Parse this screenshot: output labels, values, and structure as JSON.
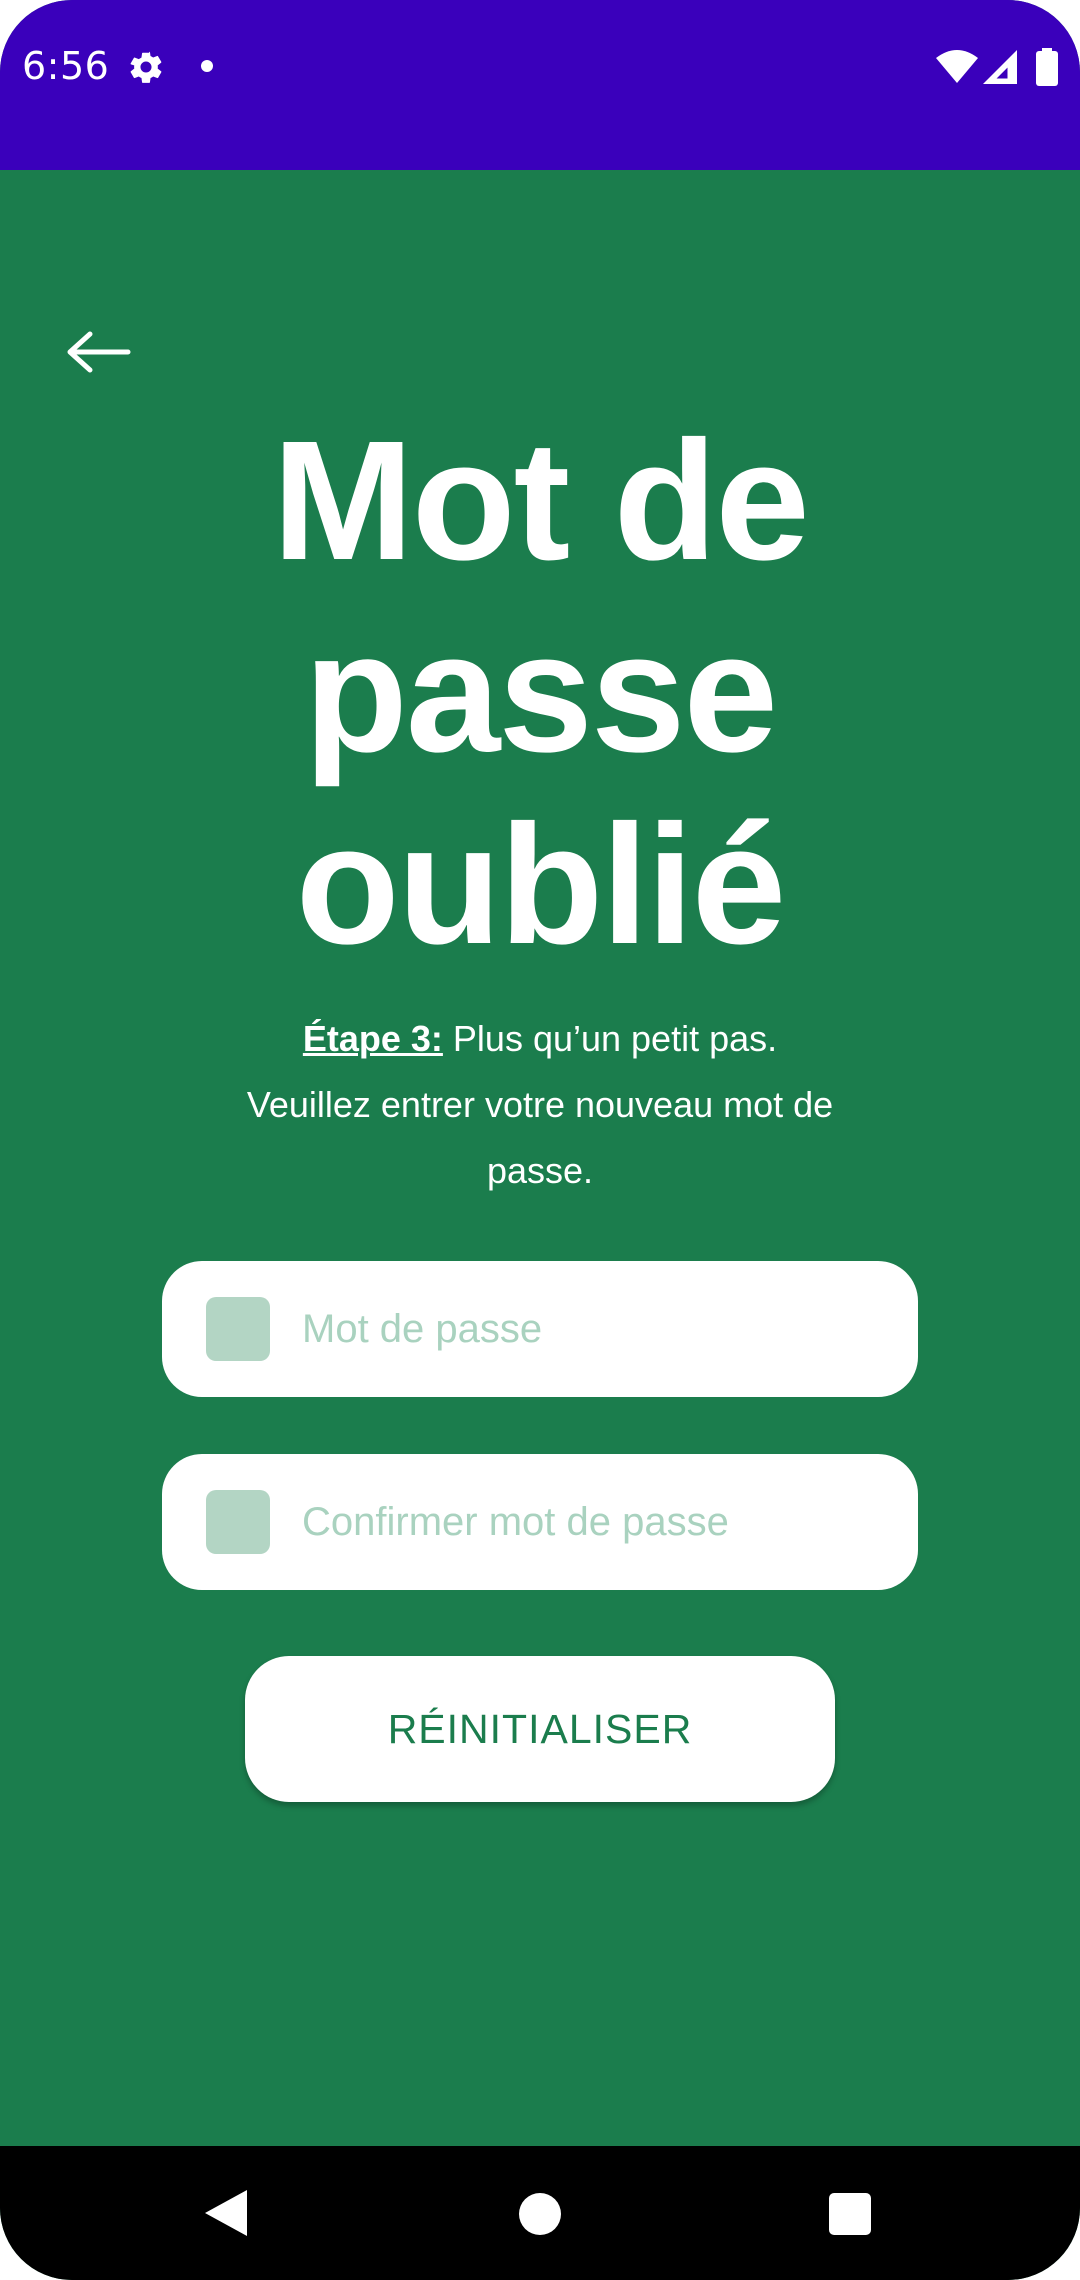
{
  "status_bar": {
    "time": "6:56",
    "icons": [
      "gear-icon",
      "notification-dot-icon",
      "wifi-icon",
      "signal-icon",
      "battery-icon"
    ]
  },
  "header": {
    "back_icon": "arrow-left-icon",
    "title": "Mot de passe oublié"
  },
  "subtitle": {
    "step_label": "Étape 3:",
    "text": " Plus qu’un petit pas. Veuillez entrer votre nouveau mot de passe."
  },
  "form": {
    "password": {
      "placeholder": "Mot de passe",
      "value": "",
      "icon": "lock-icon"
    },
    "confirm_password": {
      "placeholder": "Confirmer mot de passe",
      "value": "",
      "icon": "lock-icon"
    },
    "submit_label": "RÉINITIALISER"
  },
  "nav_bar": {
    "icons": [
      "back-triangle-icon",
      "home-circle-icon",
      "recents-square-icon"
    ]
  },
  "colors": {
    "status_bar": "#3a00bb",
    "background": "#1b7d4d",
    "field_background": "#ffffff",
    "field_icon": "#b3d5c4",
    "placeholder": "#a9d2bf",
    "button_text": "#1b7d4d",
    "nav_bar": "#000000"
  }
}
